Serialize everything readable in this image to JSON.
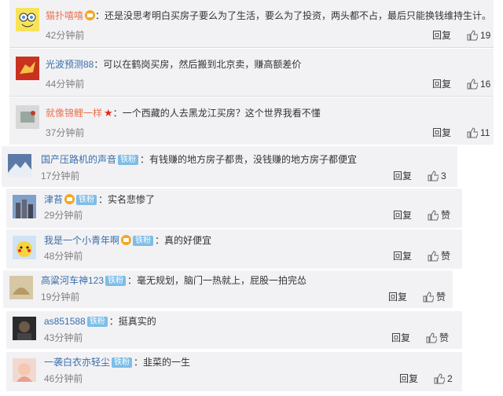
{
  "separator": "：",
  "reply_label": "回复",
  "comments": [
    {
      "user": "猫扑嘻嘻",
      "text": "还是没思考明白买房子要么为了生活，要么为了投资，两头都不占，最后只能换钱维持生计。",
      "time": "42分钟前",
      "likes": "19",
      "badge": "",
      "icon": "crown-icon",
      "avatar": "sponge"
    },
    {
      "user": "光波预测88",
      "text": "可以在鹤岗买房，然后搬到北京卖，赚高额差价",
      "time": "44分钟前",
      "likes": "16",
      "badge": "",
      "icon": "",
      "avatar": "horse"
    },
    {
      "user": "就像锦鲤一样",
      "text": "一个西藏的人去黑龙江买房？这个世界我看不懂",
      "time": "37分钟前",
      "likes": "11",
      "badge": "",
      "icon": "star-icon",
      "avatar": "grey"
    },
    {
      "user": "国产压路机的声音",
      "text": "有钱赚的地方房子都贵，没钱赚的地方房子都便宜",
      "time": "17分钟前",
      "likes": "3",
      "badge": "铁粉",
      "icon": "",
      "avatar": "mountain"
    },
    {
      "user": "津苔",
      "text": "实名悲惨了",
      "time": "29分钟前",
      "likes": "赞",
      "badge": "铁粉",
      "icon": "crown-icon",
      "avatar": "city"
    },
    {
      "user": "我是一个小青年啊",
      "text": "真的好便宜",
      "time": "48分钟前",
      "likes": "赞",
      "badge": "铁粉",
      "icon": "crown-icon",
      "avatar": "pika"
    },
    {
      "user": "高粱河车神123",
      "text": "毫无规划，脑门一热就上，屁股一拍完怂",
      "time": "19分钟前",
      "likes": "赞",
      "badge": "铁粉",
      "icon": "",
      "avatar": "tan"
    },
    {
      "user": "as851588",
      "text": "挺真实的",
      "time": "43分钟前",
      "likes": "赞",
      "badge": "铁粉",
      "icon": "",
      "avatar": "dark"
    },
    {
      "user": "一袭白衣亦轻尘",
      "text": "韭菜的一生",
      "time": "46分钟前",
      "likes": "2",
      "badge": "铁粉",
      "icon": "",
      "avatar": "girl"
    }
  ]
}
